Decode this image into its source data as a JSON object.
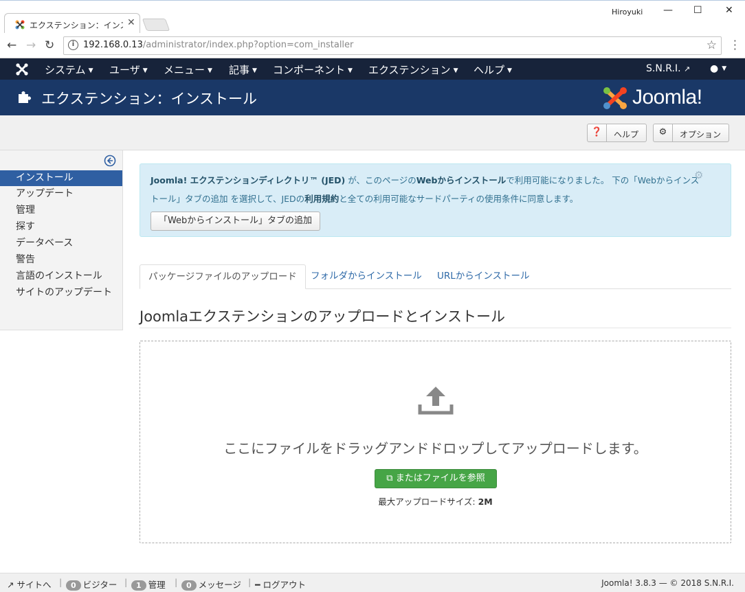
{
  "browser": {
    "tab_title": "エクステンション：インストール",
    "user": "Hiroyuki",
    "url_host": "192.168.0.13",
    "url_path": "/administrator/index.php?option=com_installer"
  },
  "navbar": {
    "items": [
      "システム",
      "ユーザ",
      "メニュー",
      "記事",
      "コンポーネント",
      "エクステンション",
      "ヘルプ"
    ],
    "site_name": "S.N.R.I."
  },
  "header": {
    "title": "エクステンション：インストール",
    "brand": "Joomla!"
  },
  "toolbar": {
    "help_label": "ヘルプ",
    "options_label": "オプション"
  },
  "sidebar": {
    "items": [
      "インストール",
      "アップデート",
      "管理",
      "探す",
      "データベース",
      "警告",
      "言語のインストール",
      "サイトのアップデート"
    ]
  },
  "alert": {
    "text_a": "Joomla! エクステンションディレクトリ™ (JED)",
    "text_b": " が、このページの",
    "text_c": "Webからインストール",
    "text_d": "で利用可能になりました。 下の「Webからインストール」タブの追加 を選択して、JEDの",
    "text_e": "利用規約",
    "text_f": "と全ての利用可能なサードパーティの使用条件に同意します。",
    "button": "「Webからインストール」タブの追加"
  },
  "tabs": [
    "パッケージファイルのアップロード",
    "フォルダからインストール",
    "URLからインストール"
  ],
  "main": {
    "section_title": "Joomlaエクステンションのアップロードとインストール",
    "drop_text": "ここにファイルをドラッグアンドドロップしてアップロードします。",
    "browse_button": "またはファイルを参照",
    "max_size_label": "最大アップロードサイズ: ",
    "max_size_value": "2M"
  },
  "footer": {
    "site_link": "サイトへ",
    "visitors_count": "0",
    "visitors_label": "ビジター",
    "admins_count": "1",
    "admins_label": "管理",
    "messages_count": "0",
    "messages_label": "メッセージ",
    "logout_label": "ログアウト",
    "version": "Joomla! 3.8.3 — © 2018 S.N.R.I."
  },
  "colors": {
    "navbar_bg": "#17233a",
    "header_bg": "#1a3867",
    "active_sidebar": "#2f5fa2",
    "success": "#46a546",
    "alert_bg": "#d9edf7"
  }
}
